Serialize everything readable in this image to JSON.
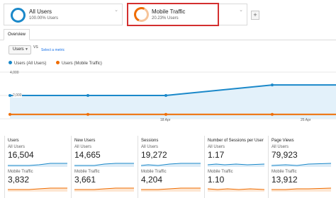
{
  "segments": {
    "all": {
      "name": "All Users",
      "percent": "100.00% Users",
      "color": "#1a88c9"
    },
    "mobile": {
      "name": "Mobile Traffic",
      "percent": "20.23% Users",
      "color": "#ef6c00",
      "share": 0.2023
    },
    "add_label": "+"
  },
  "tabs": {
    "overview": "Overview"
  },
  "controls": {
    "metric_select": "Users",
    "vs": "VS",
    "select_metric": "Select a metric"
  },
  "legend": [
    {
      "label": "Users (All Users)",
      "color": "#1a88c9"
    },
    {
      "label": "Users (Mobile Traffic)",
      "color": "#ef6c00"
    }
  ],
  "chart_data": {
    "type": "line",
    "yticks": [
      "4,000",
      "2,000"
    ],
    "xticks": [
      "18 Apr",
      "25 Apr"
    ],
    "ylim": [
      0,
      4000
    ],
    "series": [
      {
        "name": "Users (All Users)",
        "color": "#1a88c9",
        "values": [
          2000,
          2000,
          2000,
          2900,
          2900
        ]
      },
      {
        "name": "Users (Mobile Traffic)",
        "color": "#ef6c00",
        "values": [
          380,
          380,
          380,
          380,
          380
        ]
      }
    ]
  },
  "scorecards": [
    {
      "title": "Users",
      "seg1": "All Users",
      "val1": "16,504",
      "seg2": "Mobile Traffic",
      "val2": "3,832"
    },
    {
      "title": "New Users",
      "seg1": "All Users",
      "val1": "14,665",
      "seg2": "Mobile Traffic",
      "val2": "3,661"
    },
    {
      "title": "Sessions",
      "seg1": "All Users",
      "val1": "19,272",
      "seg2": "Mobile Traffic",
      "val2": "4,204"
    },
    {
      "title": "Number of Sessions per User",
      "seg1": "All Users",
      "val1": "1.17",
      "seg2": "Mobile Traffic",
      "val2": "1.10"
    },
    {
      "title": "Page Views",
      "seg1": "All Users",
      "val1": "79,923",
      "seg2": "Mobile Traffic",
      "val2": "13,912"
    }
  ]
}
